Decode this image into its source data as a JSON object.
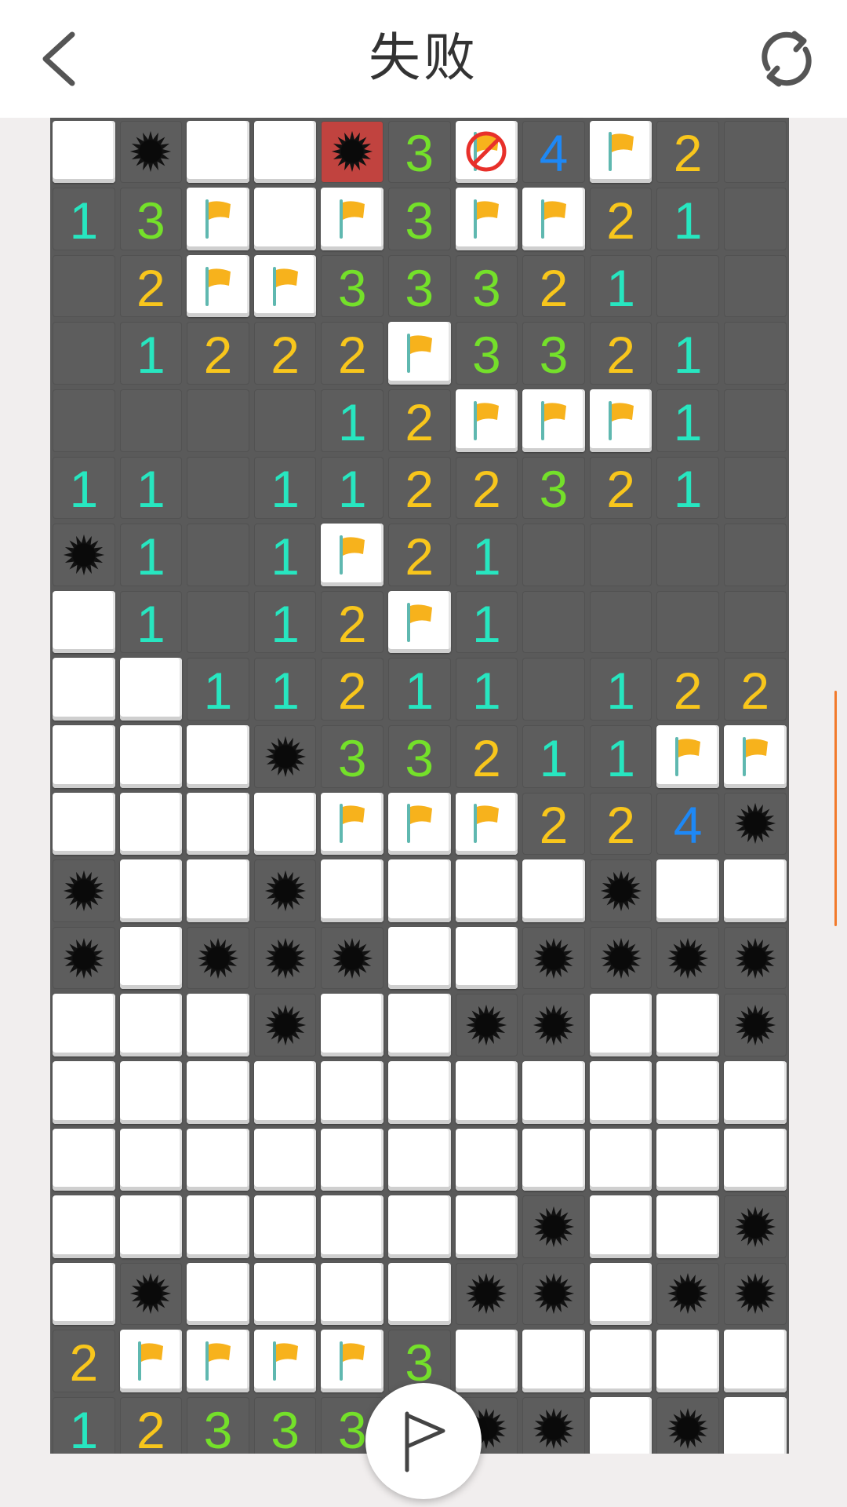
{
  "header": {
    "title": "失败",
    "back_icon": "chevron-left-icon",
    "refresh_icon": "refresh-icon"
  },
  "colors": {
    "number_1": "#27e6c0",
    "number_2": "#f8c61c",
    "number_3": "#74e02a",
    "number_4": "#1e88f5",
    "exploded": "#c1433f",
    "scroll_indicator": "#f27a2b"
  },
  "legend": {
    "C": "covered",
    "O": "open-empty",
    "1-4": "open-number",
    "F": "flag",
    "M": "mine",
    "X": "exploded-mine",
    "W": "wrong-flag"
  },
  "board": {
    "columns": 11,
    "rows": [
      [
        "C",
        "C",
        "C",
        "C",
        "C",
        "C",
        "C",
        "C",
        "C",
        "C",
        "C"
      ],
      [
        "C",
        "M",
        "C",
        "C",
        "X",
        "3",
        "W",
        "4",
        "F",
        "2",
        "O"
      ],
      [
        "1",
        "3",
        "F",
        "C",
        "F",
        "3",
        "F",
        "F",
        "2",
        "1",
        "O"
      ],
      [
        "O",
        "2",
        "F",
        "F",
        "3",
        "3",
        "3",
        "2",
        "1",
        "O",
        "O"
      ],
      [
        "O",
        "1",
        "2",
        "2",
        "2",
        "F",
        "3",
        "3",
        "2",
        "1",
        "O"
      ],
      [
        "O",
        "O",
        "O",
        "O",
        "1",
        "2",
        "F",
        "F",
        "F",
        "1",
        "O"
      ],
      [
        "1",
        "1",
        "O",
        "1",
        "1",
        "2",
        "2",
        "3",
        "2",
        "1",
        "O"
      ],
      [
        "M",
        "1",
        "O",
        "1",
        "F",
        "2",
        "1",
        "O",
        "O",
        "O",
        "O"
      ],
      [
        "C",
        "1",
        "O",
        "1",
        "2",
        "F",
        "1",
        "O",
        "O",
        "O",
        "O"
      ],
      [
        "C",
        "C",
        "1",
        "1",
        "2",
        "1",
        "1",
        "O",
        "1",
        "2",
        "2"
      ],
      [
        "C",
        "C",
        "C",
        "M",
        "3",
        "3",
        "2",
        "1",
        "1",
        "F",
        "F"
      ],
      [
        "C",
        "C",
        "C",
        "C",
        "F",
        "F",
        "F",
        "2",
        "2",
        "4",
        "M"
      ],
      [
        "M",
        "C",
        "C",
        "M",
        "C",
        "C",
        "C",
        "C",
        "M",
        "C",
        "C"
      ],
      [
        "M",
        "C",
        "M",
        "M",
        "M",
        "C",
        "C",
        "M",
        "M",
        "M",
        "M"
      ],
      [
        "C",
        "C",
        "C",
        "M",
        "C",
        "C",
        "M",
        "M",
        "C",
        "C",
        "M"
      ],
      [
        "C",
        "C",
        "C",
        "C",
        "C",
        "C",
        "C",
        "C",
        "C",
        "C",
        "C"
      ],
      [
        "C",
        "C",
        "C",
        "C",
        "C",
        "C",
        "C",
        "C",
        "C",
        "C",
        "C"
      ],
      [
        "C",
        "C",
        "C",
        "C",
        "C",
        "C",
        "C",
        "M",
        "C",
        "C",
        "M"
      ],
      [
        "C",
        "M",
        "C",
        "C",
        "C",
        "C",
        "M",
        "M",
        "C",
        "M",
        "M"
      ],
      [
        "2",
        "F",
        "F",
        "F",
        "F",
        "3",
        "C",
        "C",
        "C",
        "C",
        "C"
      ],
      [
        "1",
        "2",
        "3",
        "3",
        "3",
        "M",
        "M",
        "M",
        "C",
        "M",
        "C"
      ]
    ]
  },
  "fab": {
    "icon": "flag-outline-icon"
  }
}
